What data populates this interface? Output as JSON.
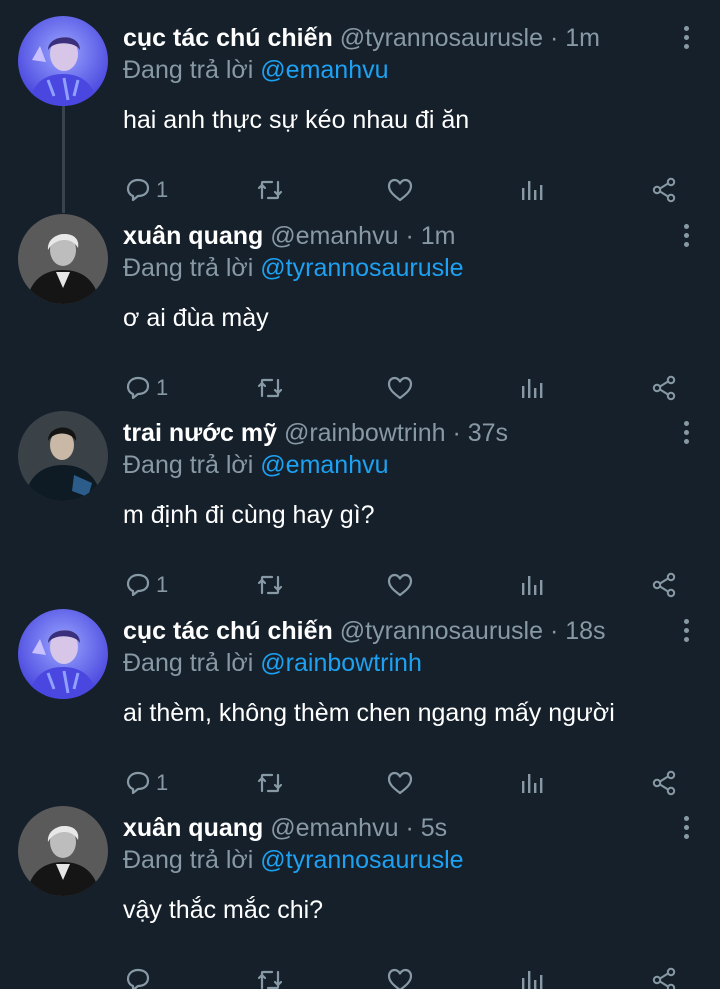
{
  "tweets": [
    {
      "name": "cục tác chú chiến",
      "handle": "@tyrannosaurusle",
      "dot": "·",
      "time": "1m",
      "reply_prefix": "Đang trả lời",
      "reply_to": "@emanhvu",
      "text": "hai anh thực sự kéo nhau đi ăn",
      "reply_count": "1",
      "avatar": "avatar-blue"
    },
    {
      "name": "xuân quang",
      "handle": "@emanhvu",
      "dot": "·",
      "time": "1m",
      "reply_prefix": "Đang trả lời",
      "reply_to": "@tyrannosaurusle",
      "text": "ơ ai đùa mày",
      "reply_count": "1",
      "avatar": "avatar-bw"
    },
    {
      "name": "trai nước mỹ",
      "handle": "@rainbowtrinh",
      "dot": "·",
      "time": "37s",
      "reply_prefix": "Đang trả lời",
      "reply_to": "@emanhvu",
      "text": "m định đi cùng hay gì?",
      "reply_count": "1",
      "avatar": "avatar-dark"
    },
    {
      "name": "cục tác chú chiến",
      "handle": "@tyrannosaurusle",
      "dot": "·",
      "time": "18s",
      "reply_prefix": "Đang trả lời",
      "reply_to": "@rainbowtrinh",
      "text": "ai thèm, không thèm chen ngang mấy người",
      "reply_count": "1",
      "avatar": "avatar-blue"
    },
    {
      "name": "xuân quang",
      "handle": "@emanhvu",
      "dot": "·",
      "time": "5s",
      "reply_prefix": "Đang trả lời",
      "reply_to": "@tyrannosaurusle",
      "text": "vậy thắc mắc chi?",
      "reply_count": "",
      "avatar": "avatar-bw"
    }
  ],
  "colors": {
    "background": "#15202b",
    "secondary_text": "#8899a6",
    "link": "#1da1f2",
    "thread_line": "#38444d"
  },
  "icons": {
    "reply": "reply-icon",
    "retweet": "retweet-icon",
    "like": "heart-icon",
    "analytics": "analytics-icon",
    "share": "share-icon",
    "more": "more-vertical-icon"
  }
}
